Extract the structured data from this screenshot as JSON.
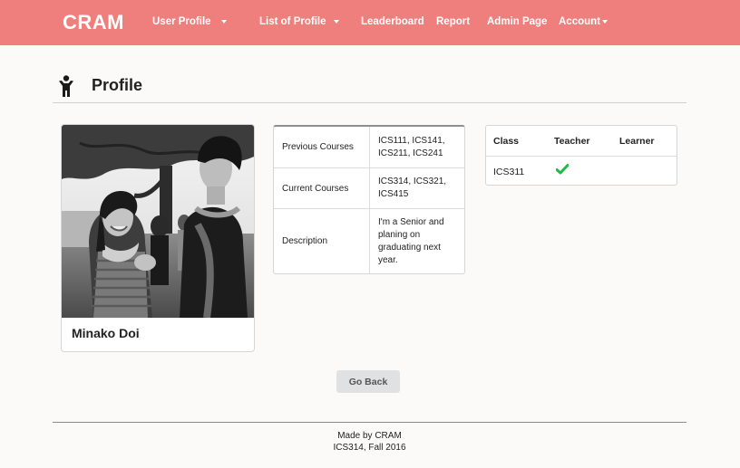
{
  "navbar": {
    "brand": "CRAM",
    "items": [
      {
        "label": "User Profile",
        "has_dropdown": true
      },
      {
        "label": "List of Profile",
        "has_dropdown": true
      },
      {
        "label": "Leaderboard",
        "has_dropdown": false
      },
      {
        "label": "Report",
        "has_dropdown": false
      },
      {
        "label": "Admin Page",
        "has_dropdown": false
      },
      {
        "label": "Account",
        "has_dropdown": true
      }
    ],
    "color": "#ef7f7c"
  },
  "header": {
    "title": "Profile",
    "icon": "person-icon"
  },
  "profile": {
    "name": "Minako Doi",
    "photo_icon": "profile-photo"
  },
  "info_table": {
    "rows": [
      {
        "label": "Previous Courses",
        "value": "ICS111, ICS141, ICS211, ICS241"
      },
      {
        "label": "Current Courses",
        "value": "ICS314, ICS321, ICS415"
      },
      {
        "label": "Description",
        "value": "I'm a Senior and planing on graduating next year."
      }
    ]
  },
  "class_table": {
    "headers": [
      "Class",
      "Teacher",
      "Learner"
    ],
    "rows": [
      {
        "class": "ICS311",
        "teacher": true,
        "learner": false
      }
    ],
    "check_color": "#21ba45"
  },
  "actions": {
    "go_back": "Go Back"
  },
  "footer": {
    "line1": "Made by CRAM",
    "line2": "ICS314, Fall 2016"
  }
}
